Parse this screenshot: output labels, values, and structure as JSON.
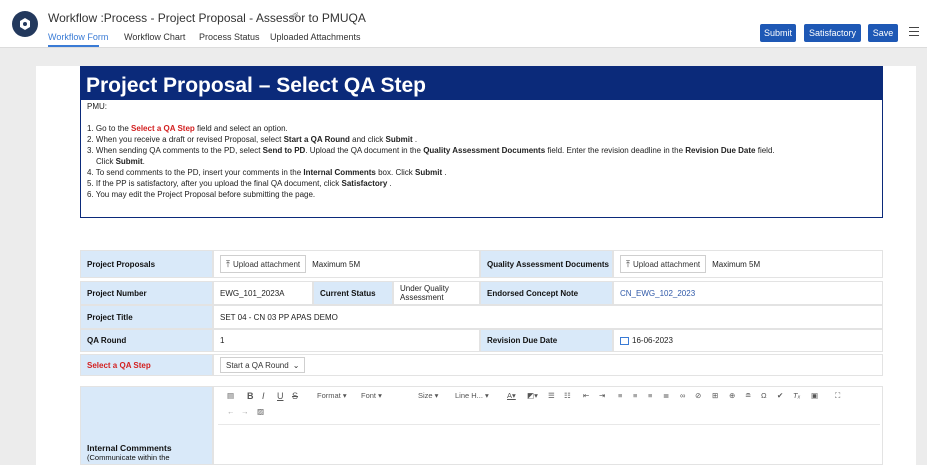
{
  "header": {
    "title": "Workflow :Process - Project Proposal - Assessor to PMUQA",
    "tabs": [
      "Workflow Form",
      "Workflow Chart",
      "Process Status",
      "Uploaded Attachments"
    ],
    "buttons": {
      "submit": "Submit",
      "satisfactory": "Satisfactory",
      "save": "Save"
    }
  },
  "banner": {
    "title": "Project Proposal – Select QA Step"
  },
  "instructions": {
    "intro": "PMU:",
    "steps": [
      {
        "num": "1.",
        "parts": [
          "Go to the ",
          "Select a QA Step",
          " field and select an option."
        ]
      },
      {
        "num": "2.",
        "parts": [
          "When you receive a draft or revised Proposal, select ",
          "Start a QA Round",
          " and click ",
          "Submit",
          " ."
        ]
      },
      {
        "num": "3.",
        "parts": [
          "When sending QA comments to the PD, select ",
          "Send to PD",
          ". Upload the QA document in the ",
          "Quality Assessment Documents",
          " field. Enter the revision deadline in the ",
          "Revision Due Date",
          " field."
        ],
        "cont": [
          "Click ",
          "Submit",
          "."
        ]
      },
      {
        "num": "4.",
        "parts": [
          "To send comments to the PD, insert your comments in the ",
          "Internal Comments",
          " box. Click ",
          "Submit",
          " ."
        ]
      },
      {
        "num": "5.",
        "parts": [
          "If the PP is satisfactory, after you upload the final QA document, click ",
          "Satisfactory",
          " ."
        ]
      },
      {
        "num": "6.",
        "parts": [
          "You may edit the Project Proposal before submitting the page."
        ]
      }
    ]
  },
  "form": {
    "project_proposals": {
      "label": "Project Proposals",
      "upload": "Upload attachment",
      "max": "Maximum 5M"
    },
    "qa_docs": {
      "label": "Quality Assessment Documents",
      "upload": "Upload attachment",
      "max": "Maximum 5M"
    },
    "project_number": {
      "label": "Project Number",
      "value": "EWG_101_2023A"
    },
    "current_status": {
      "label": "Current Status",
      "value": "Under Quality Assessment"
    },
    "endorsed_note": {
      "label": "Endorsed Concept Note",
      "value": "CN_EWG_102_2023"
    },
    "project_title": {
      "label": "Project Title",
      "value": "SET 04 - CN 03 PP APAS DEMO"
    },
    "qa_round": {
      "label": "QA Round",
      "value": "1"
    },
    "revision_due": {
      "label": "Revision Due Date",
      "value": "16-06-2023"
    },
    "qa_step": {
      "label": "Select a QA Step",
      "value": "Start a QA Round"
    },
    "internal_comments": {
      "label": "Internal Commments",
      "sub": "(Communicate within the"
    }
  },
  "toolbar": {
    "format": "Format",
    "font": "Font",
    "size": "Size",
    "line_height": "Line H..."
  },
  "colors": {
    "accent": "#1e58b5",
    "banner": "#0b2a7a",
    "label_bg": "#d9e9f9",
    "required": "#d32020"
  }
}
